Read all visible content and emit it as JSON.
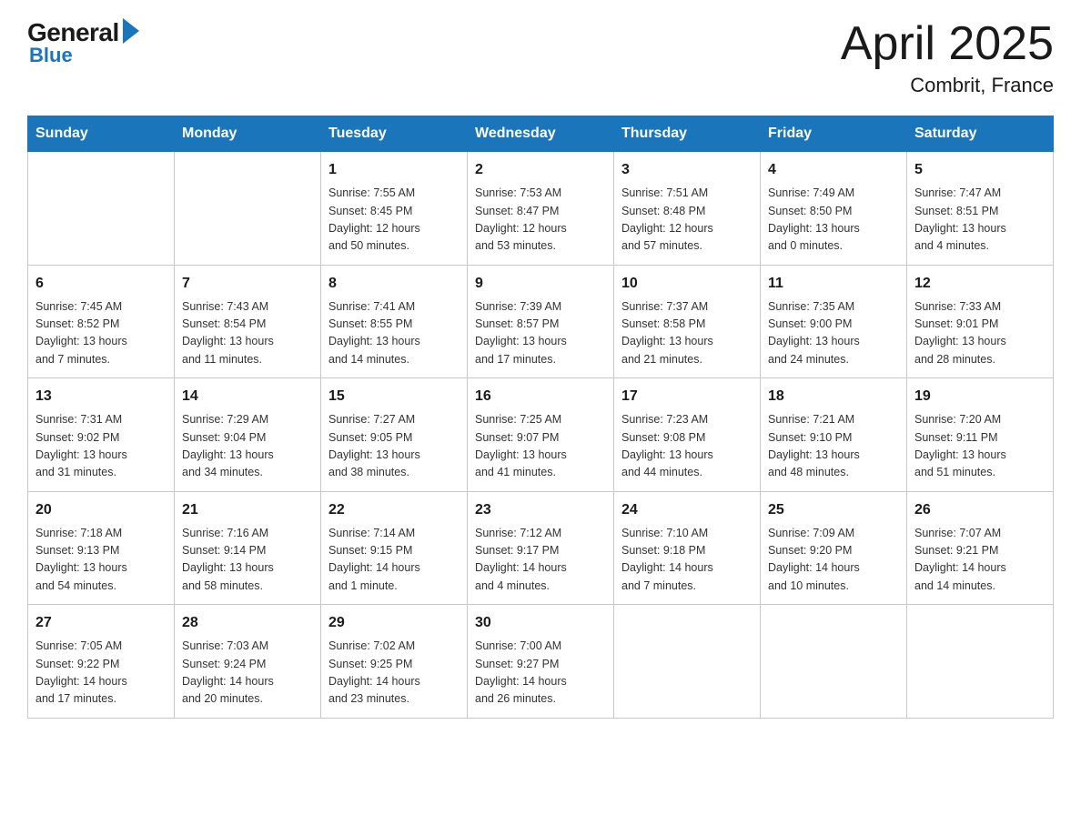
{
  "header": {
    "logo_general": "General",
    "logo_blue": "Blue",
    "title": "April 2025",
    "location": "Combrit, France"
  },
  "days_of_week": [
    "Sunday",
    "Monday",
    "Tuesday",
    "Wednesday",
    "Thursday",
    "Friday",
    "Saturday"
  ],
  "weeks": [
    [
      {
        "day": "",
        "info": ""
      },
      {
        "day": "",
        "info": ""
      },
      {
        "day": "1",
        "info": "Sunrise: 7:55 AM\nSunset: 8:45 PM\nDaylight: 12 hours\nand 50 minutes."
      },
      {
        "day": "2",
        "info": "Sunrise: 7:53 AM\nSunset: 8:47 PM\nDaylight: 12 hours\nand 53 minutes."
      },
      {
        "day": "3",
        "info": "Sunrise: 7:51 AM\nSunset: 8:48 PM\nDaylight: 12 hours\nand 57 minutes."
      },
      {
        "day": "4",
        "info": "Sunrise: 7:49 AM\nSunset: 8:50 PM\nDaylight: 13 hours\nand 0 minutes."
      },
      {
        "day": "5",
        "info": "Sunrise: 7:47 AM\nSunset: 8:51 PM\nDaylight: 13 hours\nand 4 minutes."
      }
    ],
    [
      {
        "day": "6",
        "info": "Sunrise: 7:45 AM\nSunset: 8:52 PM\nDaylight: 13 hours\nand 7 minutes."
      },
      {
        "day": "7",
        "info": "Sunrise: 7:43 AM\nSunset: 8:54 PM\nDaylight: 13 hours\nand 11 minutes."
      },
      {
        "day": "8",
        "info": "Sunrise: 7:41 AM\nSunset: 8:55 PM\nDaylight: 13 hours\nand 14 minutes."
      },
      {
        "day": "9",
        "info": "Sunrise: 7:39 AM\nSunset: 8:57 PM\nDaylight: 13 hours\nand 17 minutes."
      },
      {
        "day": "10",
        "info": "Sunrise: 7:37 AM\nSunset: 8:58 PM\nDaylight: 13 hours\nand 21 minutes."
      },
      {
        "day": "11",
        "info": "Sunrise: 7:35 AM\nSunset: 9:00 PM\nDaylight: 13 hours\nand 24 minutes."
      },
      {
        "day": "12",
        "info": "Sunrise: 7:33 AM\nSunset: 9:01 PM\nDaylight: 13 hours\nand 28 minutes."
      }
    ],
    [
      {
        "day": "13",
        "info": "Sunrise: 7:31 AM\nSunset: 9:02 PM\nDaylight: 13 hours\nand 31 minutes."
      },
      {
        "day": "14",
        "info": "Sunrise: 7:29 AM\nSunset: 9:04 PM\nDaylight: 13 hours\nand 34 minutes."
      },
      {
        "day": "15",
        "info": "Sunrise: 7:27 AM\nSunset: 9:05 PM\nDaylight: 13 hours\nand 38 minutes."
      },
      {
        "day": "16",
        "info": "Sunrise: 7:25 AM\nSunset: 9:07 PM\nDaylight: 13 hours\nand 41 minutes."
      },
      {
        "day": "17",
        "info": "Sunrise: 7:23 AM\nSunset: 9:08 PM\nDaylight: 13 hours\nand 44 minutes."
      },
      {
        "day": "18",
        "info": "Sunrise: 7:21 AM\nSunset: 9:10 PM\nDaylight: 13 hours\nand 48 minutes."
      },
      {
        "day": "19",
        "info": "Sunrise: 7:20 AM\nSunset: 9:11 PM\nDaylight: 13 hours\nand 51 minutes."
      }
    ],
    [
      {
        "day": "20",
        "info": "Sunrise: 7:18 AM\nSunset: 9:13 PM\nDaylight: 13 hours\nand 54 minutes."
      },
      {
        "day": "21",
        "info": "Sunrise: 7:16 AM\nSunset: 9:14 PM\nDaylight: 13 hours\nand 58 minutes."
      },
      {
        "day": "22",
        "info": "Sunrise: 7:14 AM\nSunset: 9:15 PM\nDaylight: 14 hours\nand 1 minute."
      },
      {
        "day": "23",
        "info": "Sunrise: 7:12 AM\nSunset: 9:17 PM\nDaylight: 14 hours\nand 4 minutes."
      },
      {
        "day": "24",
        "info": "Sunrise: 7:10 AM\nSunset: 9:18 PM\nDaylight: 14 hours\nand 7 minutes."
      },
      {
        "day": "25",
        "info": "Sunrise: 7:09 AM\nSunset: 9:20 PM\nDaylight: 14 hours\nand 10 minutes."
      },
      {
        "day": "26",
        "info": "Sunrise: 7:07 AM\nSunset: 9:21 PM\nDaylight: 14 hours\nand 14 minutes."
      }
    ],
    [
      {
        "day": "27",
        "info": "Sunrise: 7:05 AM\nSunset: 9:22 PM\nDaylight: 14 hours\nand 17 minutes."
      },
      {
        "day": "28",
        "info": "Sunrise: 7:03 AM\nSunset: 9:24 PM\nDaylight: 14 hours\nand 20 minutes."
      },
      {
        "day": "29",
        "info": "Sunrise: 7:02 AM\nSunset: 9:25 PM\nDaylight: 14 hours\nand 23 minutes."
      },
      {
        "day": "30",
        "info": "Sunrise: 7:00 AM\nSunset: 9:27 PM\nDaylight: 14 hours\nand 26 minutes."
      },
      {
        "day": "",
        "info": ""
      },
      {
        "day": "",
        "info": ""
      },
      {
        "day": "",
        "info": ""
      }
    ]
  ]
}
